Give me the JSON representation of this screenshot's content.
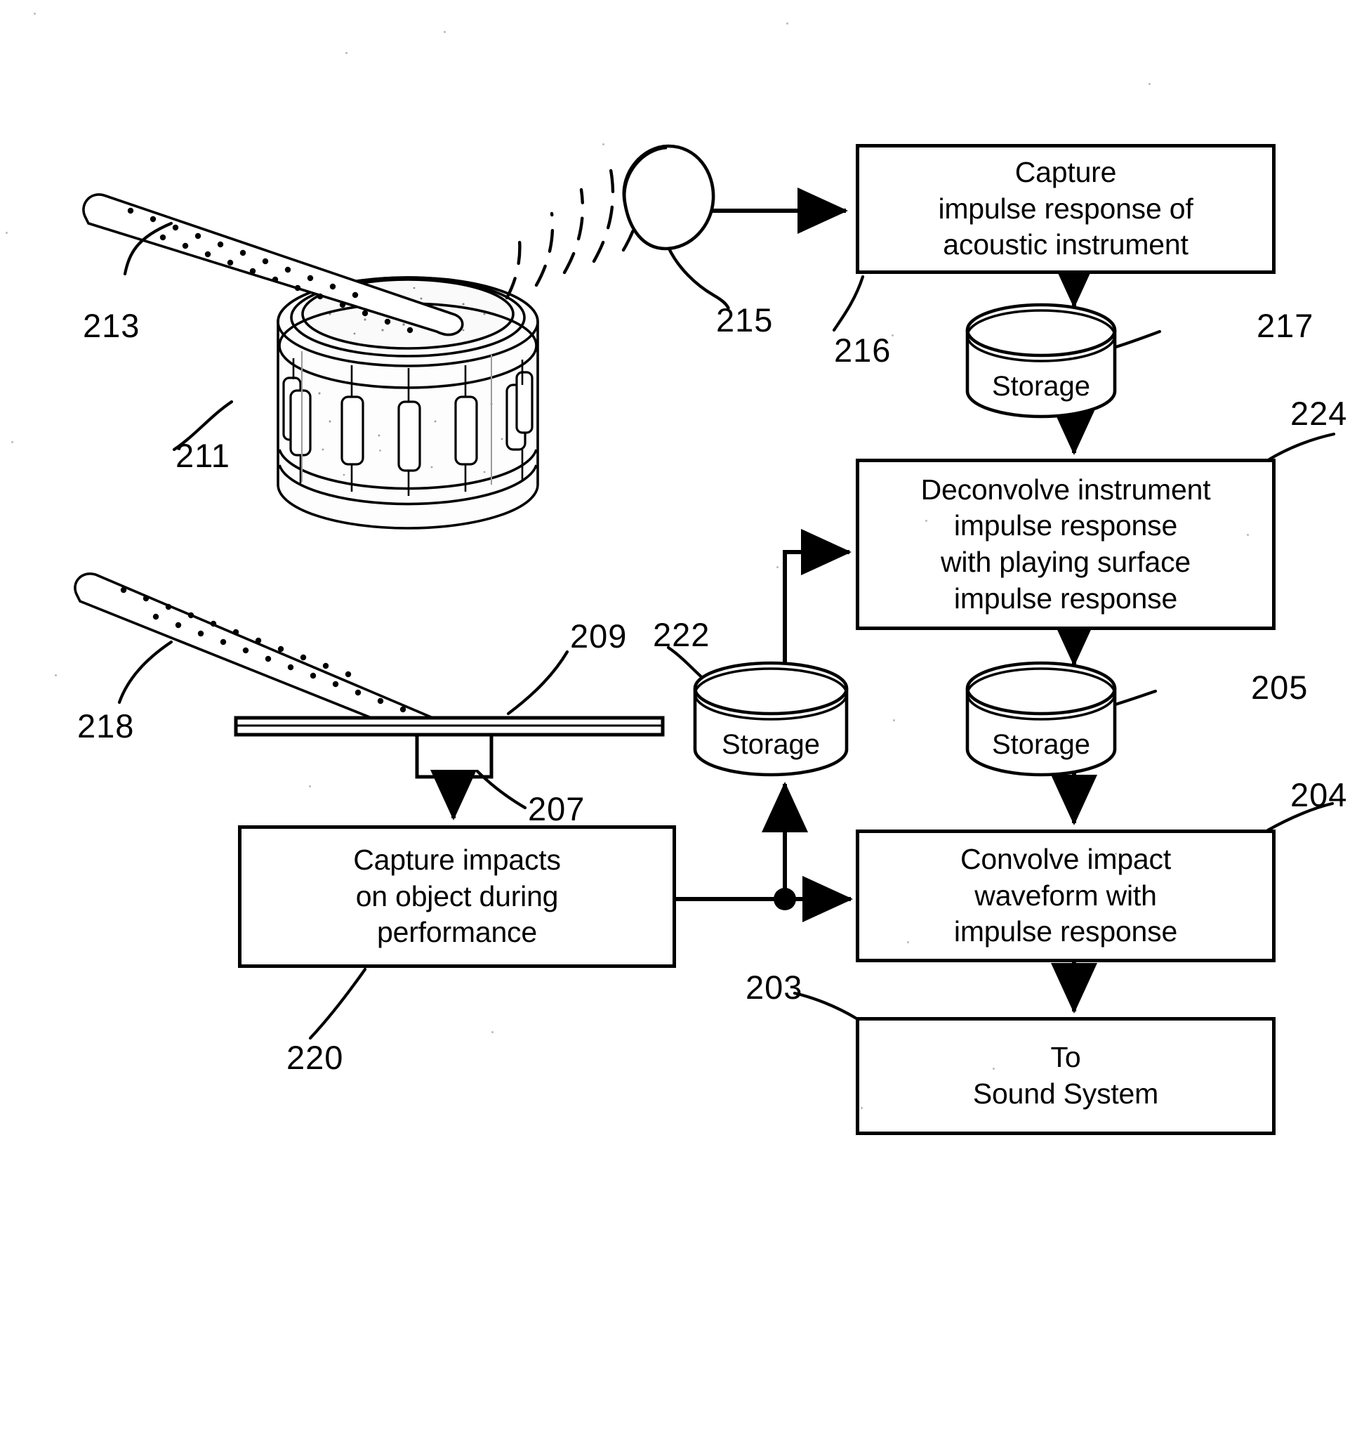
{
  "figure": {
    "type": "patent-flow-diagram",
    "background_color": "#ffffff",
    "ink_color": "#000000"
  },
  "blocks": [
    {
      "id": "216",
      "name": "capture-impulse-response-block",
      "text": "Capture\nimpulse response of\nacoustic instrument"
    },
    {
      "id": "224",
      "name": "deconvolve-block",
      "text": "Deconvolve instrument\nimpulse response\nwith playing surface\nimpulse response"
    },
    {
      "id": "204",
      "name": "convolve-block",
      "text": "Convolve impact\nwaveform with\nimpulse response"
    },
    {
      "id": "203",
      "name": "to-sound-system-block",
      "text": "To\nSound System"
    },
    {
      "id": "220",
      "name": "capture-impacts-block",
      "text": "Capture impacts\non object during\nperformance"
    }
  ],
  "storages": [
    {
      "id": "217",
      "name": "storage-instrument-ir",
      "label": "Storage"
    },
    {
      "id": "205",
      "name": "storage-deconvolved-ir",
      "label": "Storage"
    },
    {
      "id": "222",
      "name": "storage-impact-waveform",
      "label": "Storage"
    }
  ],
  "reference_numerals": [
    {
      "id": "213",
      "text": "213",
      "target": "drumstick-upper"
    },
    {
      "id": "211",
      "text": "211",
      "target": "snare-drum"
    },
    {
      "id": "215",
      "text": "215",
      "target": "microphone"
    },
    {
      "id": "216",
      "text": "216",
      "target": "capture-impulse-response-block"
    },
    {
      "id": "217",
      "text": "217",
      "target": "storage-instrument-ir"
    },
    {
      "id": "224",
      "text": "224",
      "target": "deconvolve-block"
    },
    {
      "id": "205",
      "text": "205",
      "target": "storage-deconvolved-ir"
    },
    {
      "id": "204",
      "text": "204",
      "target": "convolve-block"
    },
    {
      "id": "203",
      "text": "203",
      "target": "to-sound-system-block"
    },
    {
      "id": "222",
      "text": "222",
      "target": "storage-impact-waveform"
    },
    {
      "id": "218",
      "text": "218",
      "target": "drumstick-lower"
    },
    {
      "id": "209",
      "text": "209",
      "target": "playing-surface-plate"
    },
    {
      "id": "207",
      "text": "207",
      "target": "impact-sensor"
    },
    {
      "id": "220",
      "text": "220",
      "target": "capture-impacts-block"
    }
  ],
  "illustration": {
    "drum": {
      "name": "snare-drum",
      "description": "acoustic snare drum in perspective"
    },
    "stick_upper": {
      "name": "drumstick-upper",
      "description": "drumstick striking drum head"
    },
    "stick_lower": {
      "name": "drumstick-lower",
      "description": "drumstick striking flat playing surface"
    },
    "microphone": {
      "name": "microphone",
      "description": "dome microphone receiving sound waves"
    },
    "sound_waves": {
      "name": "sound-wave-arcs",
      "count": 5
    },
    "plate": {
      "name": "playing-surface-plate",
      "description": "thin flat plate"
    },
    "sensor": {
      "name": "impact-sensor",
      "description": "transducer block under plate"
    }
  }
}
